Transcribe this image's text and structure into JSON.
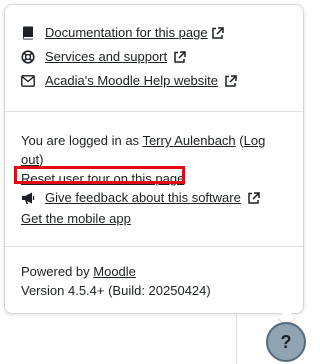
{
  "footer_popover": {
    "links": [
      {
        "label": "Documentation for this page",
        "icon": "book-icon",
        "external": true
      },
      {
        "label": "Services and support",
        "icon": "life-ring-icon",
        "external": true
      },
      {
        "label": "Acadia's Moodle Help website",
        "icon": "envelope-icon",
        "external": true
      }
    ],
    "login": {
      "prefix": "You are logged in as ",
      "user_name": "Terry Aulenbach",
      "logout_open": " (",
      "logout_label_1": "Log",
      "logout_label_2": "out",
      "logout_close": ")"
    },
    "reset_tour_label": "Reset user tour on this page",
    "feedback_label": "Give feedback about this software",
    "mobile_app_label": "Get the mobile app",
    "powered_by_prefix": "Powered by ",
    "powered_by_link": "Moodle",
    "version_text": "Version 4.5.4+ (Build: 20250424)"
  },
  "help_button": {
    "label": "?"
  },
  "colors": {
    "highlight": "#e30613",
    "help_button_bg": "#8fa3b3"
  }
}
